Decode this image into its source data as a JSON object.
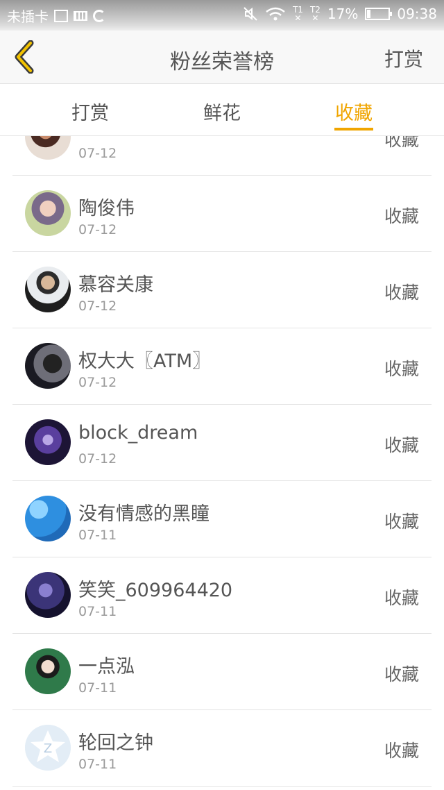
{
  "status_bar": {
    "carrier": "未插卡",
    "sim1": "T1",
    "sim2": "T2",
    "battery": "17%",
    "battery_level": 0.17,
    "time": "09:38"
  },
  "header": {
    "title": "粉丝荣誉榜",
    "action_label": "打赏",
    "accent_color": "#f0a500"
  },
  "tabs": [
    {
      "label": "打赏"
    },
    {
      "label": "鲜花"
    },
    {
      "label": "收藏",
      "active": true
    }
  ],
  "list": [
    {
      "name": "",
      "date": "07-12",
      "type": "收藏",
      "avatar": "avatar-1"
    },
    {
      "name": "陶俊伟",
      "date": "07-12",
      "type": "收藏",
      "avatar": "avatar-2"
    },
    {
      "name": "慕容关康",
      "date": "07-12",
      "type": "收藏",
      "avatar": "avatar-3"
    },
    {
      "name": "权大大〖ATM〗",
      "date": "07-12",
      "type": "收藏",
      "avatar": "avatar-4"
    },
    {
      "name": "block_dream",
      "date": "07-12",
      "type": "收藏",
      "avatar": "avatar-5"
    },
    {
      "name": "没有情感的黑瞳",
      "date": "07-11",
      "type": "收藏",
      "avatar": "avatar-6"
    },
    {
      "name": "笑笑_609964420",
      "date": "07-11",
      "type": "收藏",
      "avatar": "avatar-7"
    },
    {
      "name": "一点泓",
      "date": "07-11",
      "type": "收藏",
      "avatar": "avatar-8"
    },
    {
      "name": "轮回之钟",
      "date": "07-11",
      "type": "收藏",
      "avatar": "avatar-9"
    }
  ]
}
